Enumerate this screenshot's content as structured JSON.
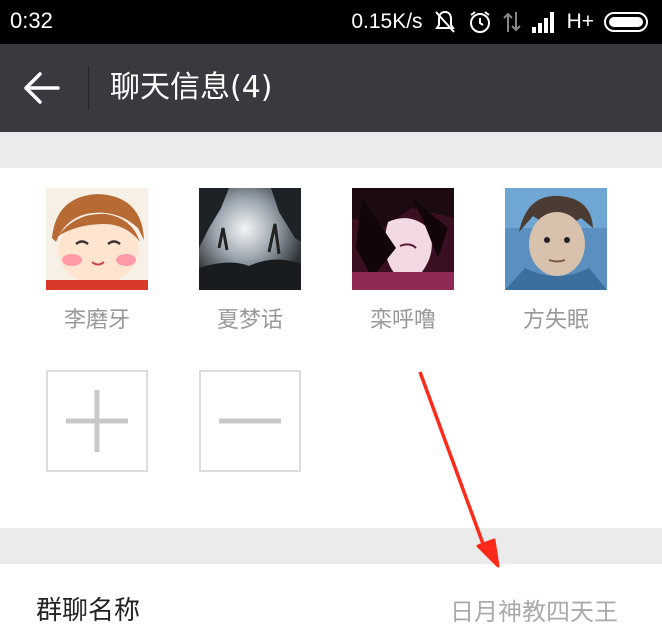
{
  "status_bar": {
    "time": "0:32",
    "speed": "0.15K/s",
    "network": "H+",
    "icons": [
      "mute-icon",
      "alarm-icon",
      "data-transfer-icon",
      "signal-icon",
      "battery-icon"
    ]
  },
  "titlebar": {
    "title": "聊天信息(4)",
    "back_icon": "back-arrow-icon"
  },
  "members": [
    {
      "name": "李磨牙"
    },
    {
      "name": "夏梦话"
    },
    {
      "name": "栾呼噜"
    },
    {
      "name": "方失眠"
    }
  ],
  "actions": {
    "add_icon": "plus-icon",
    "remove_icon": "minus-icon"
  },
  "group": {
    "label": "群聊名称",
    "value": "日月神教四天王"
  },
  "colors": {
    "titlebar_bg": "#393a3f",
    "page_bg": "#ebebeb",
    "annotation_arrow": "#ff2a1a"
  }
}
